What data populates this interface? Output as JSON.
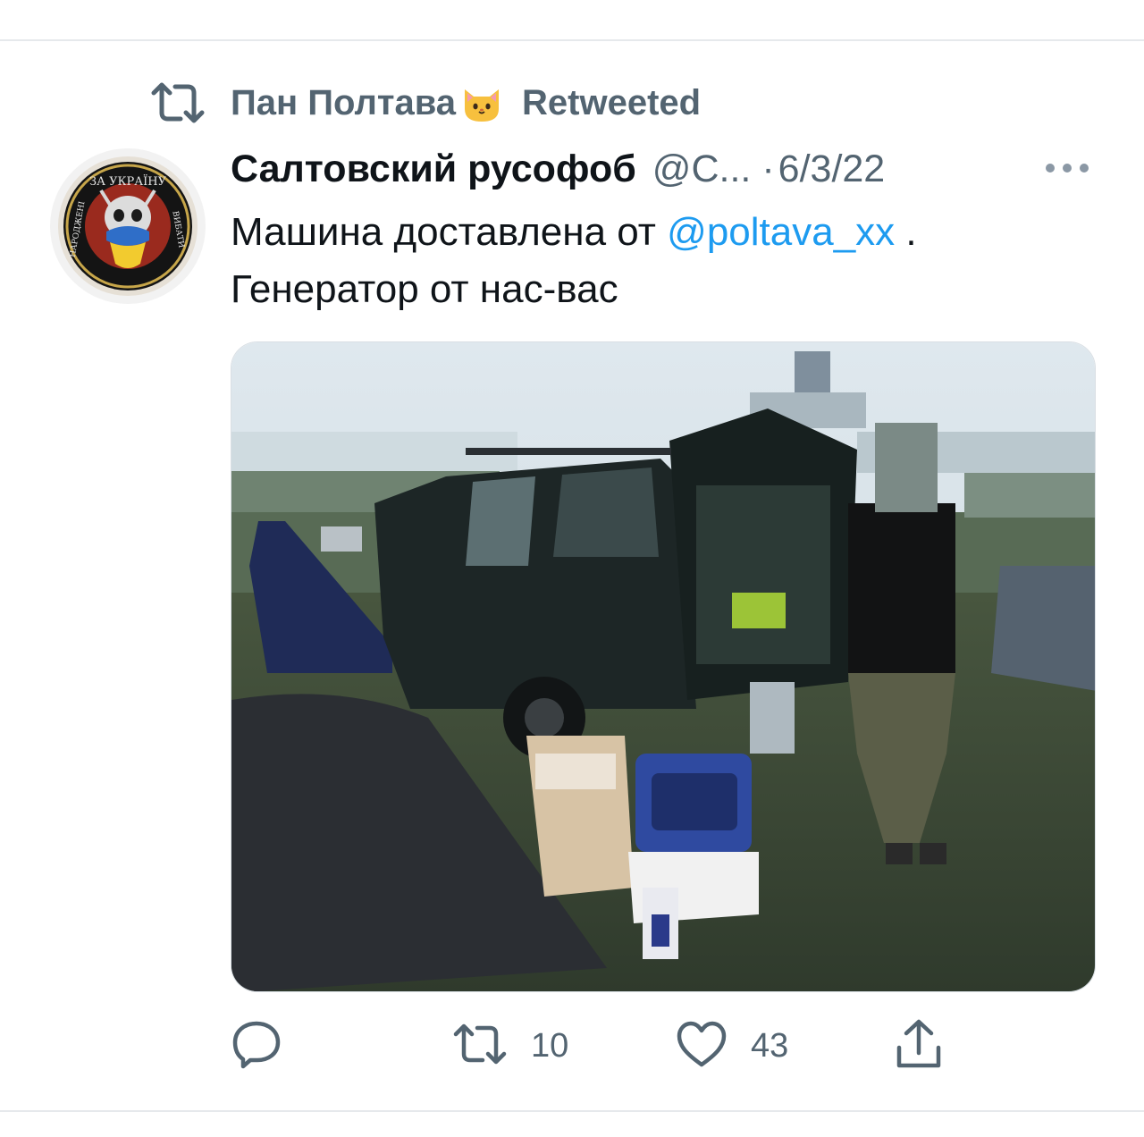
{
  "retweet_context": {
    "icon": "retweet-icon",
    "retweeter_name": "Пан Полтава",
    "retweeter_emoji": "cat-face-emoji",
    "label": "Retweeted"
  },
  "tweet": {
    "author_name": "Салтовский русофоб",
    "author_handle": "@С...",
    "date_separator": "·",
    "date": "6/3/22",
    "text_part1": "Машина доставлена от ",
    "mention": "@poltava_xx",
    "text_part2": " .",
    "text_line2": "Генератор от нас-вас",
    "avatar": {
      "badge_text_top": "ЗА УКРАЇНУ",
      "badge_text_left": "НАРОДЖЕНІ",
      "badge_text_right": "ВИБАТИ"
    }
  },
  "actions": {
    "reply": {
      "icon": "reply-icon"
    },
    "retweet": {
      "icon": "retweet-icon",
      "count": "10"
    },
    "like": {
      "icon": "heart-icon",
      "count": "43"
    },
    "share": {
      "icon": "share-icon"
    }
  },
  "colors": {
    "accent": "#1d9bf0",
    "secondary_text": "#536471",
    "primary_text": "#0f1419"
  }
}
